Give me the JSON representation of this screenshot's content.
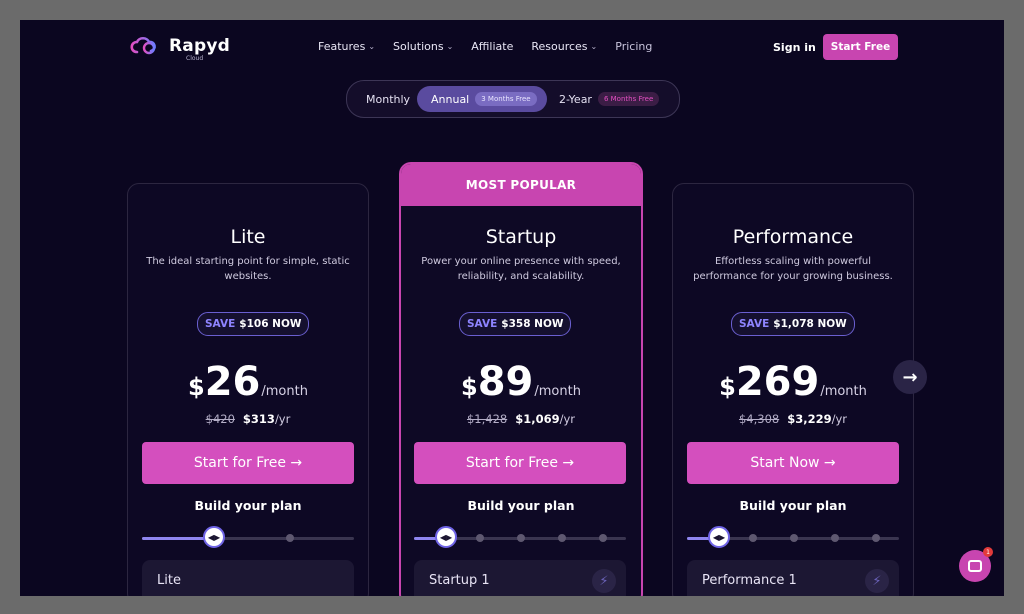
{
  "nav": {
    "brand": "Rapyd",
    "brand_sub": "Cloud",
    "menu": [
      {
        "label": "Features",
        "has_caret": true
      },
      {
        "label": "Solutions",
        "has_caret": true
      },
      {
        "label": "Affiliate",
        "has_caret": false
      },
      {
        "label": "Resources",
        "has_caret": true
      },
      {
        "label": "Pricing",
        "has_caret": false
      }
    ],
    "signin": "Sign in",
    "start_free": "Start Free"
  },
  "billing": {
    "monthly": "Monthly",
    "annual": "Annual",
    "annual_badge": "3 Months Free",
    "twoyear": "2-Year",
    "twoyear_badge": "6 Months Free",
    "selected": "Annual"
  },
  "most_popular": "MOST POPULAR",
  "plans": [
    {
      "name": "Lite",
      "description": "The ideal starting point for simple, static websites.",
      "save_label": "SAVE",
      "save_amount": "$106 NOW",
      "currency": "$",
      "price": "26",
      "period": "/month",
      "old_yearly": "$420",
      "new_yearly": "$313",
      "yearly_unit": "/yr",
      "cta": "Start for Free →",
      "build_plan": "Build your plan",
      "slider_fraction": 0.34,
      "tier": "Lite",
      "dots": 1
    },
    {
      "name": "Startup",
      "description": "Power your online presence with speed, reliability, and scalability.",
      "save_label": "SAVE",
      "save_amount": "$358 NOW",
      "currency": "$",
      "price": "89",
      "period": "/month",
      "old_yearly": "$1,428",
      "new_yearly": "$1,069",
      "yearly_unit": "/yr",
      "cta": "Start for Free →",
      "build_plan": "Build your plan",
      "slider_fraction": 0.15,
      "tier": "Startup 1",
      "dots": 4
    },
    {
      "name": "Performance",
      "description": "Effortless scaling with powerful performance for your growing business.",
      "save_label": "SAVE",
      "save_amount": "$1,078 NOW",
      "currency": "$",
      "price": "269",
      "period": "/month",
      "old_yearly": "$4,308",
      "new_yearly": "$3,229",
      "yearly_unit": "/yr",
      "cta": "Start Now →",
      "build_plan": "Build your plan",
      "slider_fraction": 0.15,
      "tier": "Performance 1",
      "dots": 4
    }
  ],
  "chat_badge": "1",
  "colors": {
    "background": "#0b0620",
    "accent": "#c845b0",
    "save_purple": "#8e84ff"
  }
}
